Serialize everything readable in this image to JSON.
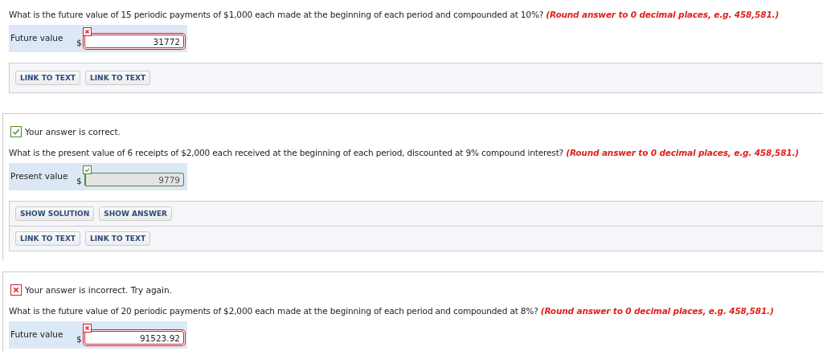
{
  "questions": [
    {
      "question": "What is the future value of 15 periodic payments of $1,000 each made at the beginning of each period and compounded at 10%?",
      "hint": "(Round answer to 0 decimal places, e.g. 458,581.)",
      "answer": {
        "label": "Future value",
        "currency": "$",
        "value": "31772",
        "correct": false
      },
      "button_rows": [
        [
          "LINK TO TEXT",
          "LINK TO TEXT"
        ]
      ]
    },
    {
      "feedback": {
        "kind": "correct",
        "text": "Your answer is correct."
      },
      "question": "What is the present value of 6 receipts of $2,000 each received at the beginning of each period, discounted at 9% compound interest?",
      "hint": "(Round answer to 0 decimal places, e.g. 458,581.)",
      "answer": {
        "label": "Present value",
        "currency": "$",
        "value": "9779",
        "correct": true
      },
      "button_rows": [
        [
          "SHOW SOLUTION",
          "SHOW ANSWER"
        ],
        [
          "LINK TO TEXT",
          "LINK TO TEXT"
        ]
      ]
    },
    {
      "feedback": {
        "kind": "incorrect",
        "text": "Your answer is incorrect.  Try again."
      },
      "question": "What is the future value of 20 periodic payments of $2,000 each made at the beginning of each period and compounded at 8%?",
      "hint": "(Round answer to 0 decimal places, e.g. 458,581.)",
      "answer": {
        "label": "Future value",
        "currency": "$",
        "value": "91523.92",
        "correct": false
      }
    }
  ]
}
